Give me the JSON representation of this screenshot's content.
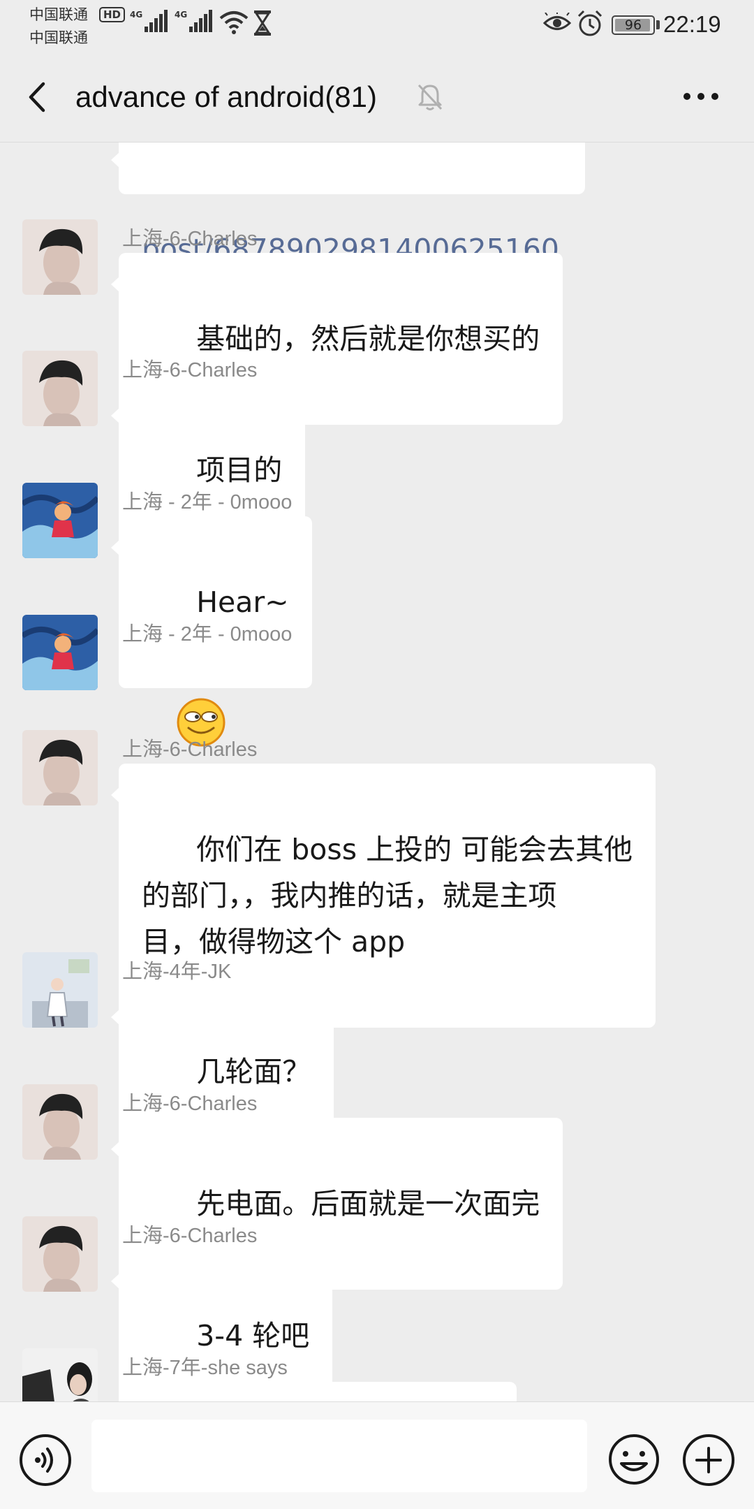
{
  "status_bar": {
    "carrier_1": "中国联通",
    "carrier_2": "中国联通",
    "hd_badge": "HD",
    "network_1": "4G",
    "network_2": "4G",
    "battery_level": "96",
    "battery_fraction": 0.96,
    "time": "22:19",
    "icons": [
      "signal-icon",
      "wifi-icon",
      "hourglass-icon",
      "eye-icon",
      "alarm-icon",
      "battery-icon"
    ]
  },
  "header": {
    "title": "advance of android(81)",
    "icons": [
      "back-icon",
      "mute-bell-icon",
      "more-icon"
    ]
  },
  "messages": [
    {
      "sender": "",
      "text": "post/6878902981400625160",
      "type": "link"
    },
    {
      "sender": "上海-6-Charles",
      "text": "基础的，然后就是你想买的",
      "avatar": "charles"
    },
    {
      "sender": "上海-6-Charles",
      "text": "项目的",
      "avatar": "charles"
    },
    {
      "sender": "上海 - 2年 - 0mooo",
      "text": "Hear~",
      "avatar": "omooo"
    },
    {
      "sender": "上海 - 2年 - 0mooo",
      "text": "",
      "type": "emoji",
      "emoji": "sly-grin-emoji",
      "avatar": "omooo"
    },
    {
      "sender": "上海-6-Charles",
      "text": "你们在 boss 上投的 可能会去其他\n的部门，，我内推的话，就是主项\n目，做得物这个 app",
      "avatar": "charles"
    },
    {
      "sender": "上海-4年-JK",
      "text": "几轮面？",
      "avatar": "jk"
    },
    {
      "sender": "上海-6-Charles",
      "text": "先电面。后面就是一次面完",
      "avatar": "charles"
    },
    {
      "sender": "上海-6-Charles",
      "text": "3-4 轮吧",
      "avatar": "charles"
    },
    {
      "sender": "上海-7年-she says",
      "text": "",
      "avatar": "shesays"
    }
  ],
  "input_bar": {
    "value": "",
    "placeholder": "",
    "icons": [
      "voice-icon",
      "emoji-icon",
      "plus-icon"
    ]
  },
  "colors": {
    "background": "#ededed",
    "bubble": "#ffffff",
    "link": "#576b95",
    "sender_name": "#8a8a8a"
  }
}
